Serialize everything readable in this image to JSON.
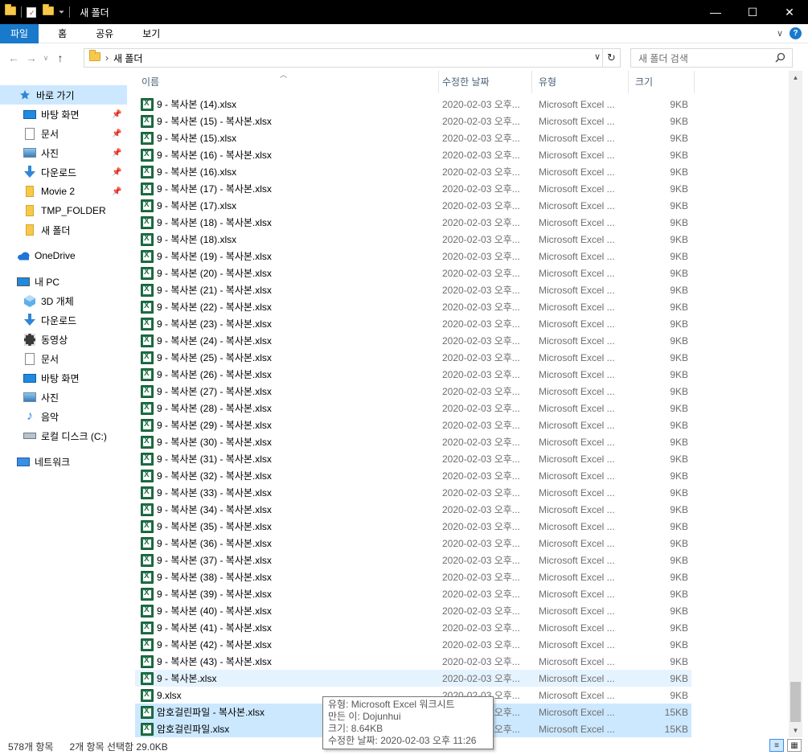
{
  "window": {
    "title": "새 폴더",
    "minimize": "—",
    "maximize": "☐",
    "close": "✕"
  },
  "ribbon": {
    "tabs": [
      "파일",
      "홈",
      "공유",
      "보기"
    ],
    "expand": "∨",
    "help": "?"
  },
  "address": {
    "back": "←",
    "forward": "→",
    "recent": "∨",
    "up": "↑",
    "separator": "›",
    "path": "새 폴더",
    "dropdown": "∨",
    "refresh": "↻"
  },
  "search": {
    "placeholder": "새 폴더 검색"
  },
  "nav": {
    "quick_access": "바로 가기",
    "items": [
      {
        "label": "바탕 화면",
        "icon": "desktop-icon",
        "pinned": true
      },
      {
        "label": "문서",
        "icon": "document-icon",
        "pinned": true
      },
      {
        "label": "사진",
        "icon": "pictures-icon",
        "pinned": true
      },
      {
        "label": "다운로드",
        "icon": "download-icon",
        "pinned": true
      },
      {
        "label": "Movie 2",
        "icon": "folder-icon",
        "pinned": true
      },
      {
        "label": "TMP_FOLDER",
        "icon": "folder-icon",
        "pinned": false
      },
      {
        "label": "새 폴더",
        "icon": "folder-icon",
        "pinned": false
      }
    ],
    "onedrive": "OneDrive",
    "thispc": "내 PC",
    "pc_items": [
      {
        "label": "3D 개체",
        "icon": "3d-objects-icon"
      },
      {
        "label": "다운로드",
        "icon": "download-icon"
      },
      {
        "label": "동영상",
        "icon": "video-icon"
      },
      {
        "label": "문서",
        "icon": "document-icon"
      },
      {
        "label": "바탕 화면",
        "icon": "desktop-icon"
      },
      {
        "label": "사진",
        "icon": "pictures-icon"
      },
      {
        "label": "음악",
        "icon": "music-icon"
      },
      {
        "label": "로컬 디스크 (C:)",
        "icon": "drive-icon"
      }
    ],
    "network": "네트워크"
  },
  "columns": {
    "name": "이름",
    "date": "수정한 날짜",
    "type": "유형",
    "size": "크기"
  },
  "files": [
    {
      "name": "9 - 복사본 (14).xlsx",
      "date": "2020-02-03 오후...",
      "type": "Microsoft Excel ...",
      "size": "9KB",
      "state": ""
    },
    {
      "name": "9 - 복사본 (15) - 복사본.xlsx",
      "date": "2020-02-03 오후...",
      "type": "Microsoft Excel ...",
      "size": "9KB",
      "state": ""
    },
    {
      "name": "9 - 복사본 (15).xlsx",
      "date": "2020-02-03 오후...",
      "type": "Microsoft Excel ...",
      "size": "9KB",
      "state": ""
    },
    {
      "name": "9 - 복사본 (16) - 복사본.xlsx",
      "date": "2020-02-03 오후...",
      "type": "Microsoft Excel ...",
      "size": "9KB",
      "state": ""
    },
    {
      "name": "9 - 복사본 (16).xlsx",
      "date": "2020-02-03 오후...",
      "type": "Microsoft Excel ...",
      "size": "9KB",
      "state": ""
    },
    {
      "name": "9 - 복사본 (17) - 복사본.xlsx",
      "date": "2020-02-03 오후...",
      "type": "Microsoft Excel ...",
      "size": "9KB",
      "state": ""
    },
    {
      "name": "9 - 복사본 (17).xlsx",
      "date": "2020-02-03 오후...",
      "type": "Microsoft Excel ...",
      "size": "9KB",
      "state": ""
    },
    {
      "name": "9 - 복사본 (18) - 복사본.xlsx",
      "date": "2020-02-03 오후...",
      "type": "Microsoft Excel ...",
      "size": "9KB",
      "state": ""
    },
    {
      "name": "9 - 복사본 (18).xlsx",
      "date": "2020-02-03 오후...",
      "type": "Microsoft Excel ...",
      "size": "9KB",
      "state": ""
    },
    {
      "name": "9 - 복사본 (19) - 복사본.xlsx",
      "date": "2020-02-03 오후...",
      "type": "Microsoft Excel ...",
      "size": "9KB",
      "state": ""
    },
    {
      "name": "9 - 복사본 (20) - 복사본.xlsx",
      "date": "2020-02-03 오후...",
      "type": "Microsoft Excel ...",
      "size": "9KB",
      "state": ""
    },
    {
      "name": "9 - 복사본 (21) - 복사본.xlsx",
      "date": "2020-02-03 오후...",
      "type": "Microsoft Excel ...",
      "size": "9KB",
      "state": ""
    },
    {
      "name": "9 - 복사본 (22) - 복사본.xlsx",
      "date": "2020-02-03 오후...",
      "type": "Microsoft Excel ...",
      "size": "9KB",
      "state": ""
    },
    {
      "name": "9 - 복사본 (23) - 복사본.xlsx",
      "date": "2020-02-03 오후...",
      "type": "Microsoft Excel ...",
      "size": "9KB",
      "state": ""
    },
    {
      "name": "9 - 복사본 (24) - 복사본.xlsx",
      "date": "2020-02-03 오후...",
      "type": "Microsoft Excel ...",
      "size": "9KB",
      "state": ""
    },
    {
      "name": "9 - 복사본 (25) - 복사본.xlsx",
      "date": "2020-02-03 오후...",
      "type": "Microsoft Excel ...",
      "size": "9KB",
      "state": ""
    },
    {
      "name": "9 - 복사본 (26) - 복사본.xlsx",
      "date": "2020-02-03 오후...",
      "type": "Microsoft Excel ...",
      "size": "9KB",
      "state": ""
    },
    {
      "name": "9 - 복사본 (27) - 복사본.xlsx",
      "date": "2020-02-03 오후...",
      "type": "Microsoft Excel ...",
      "size": "9KB",
      "state": ""
    },
    {
      "name": "9 - 복사본 (28) - 복사본.xlsx",
      "date": "2020-02-03 오후...",
      "type": "Microsoft Excel ...",
      "size": "9KB",
      "state": ""
    },
    {
      "name": "9 - 복사본 (29) - 복사본.xlsx",
      "date": "2020-02-03 오후...",
      "type": "Microsoft Excel ...",
      "size": "9KB",
      "state": ""
    },
    {
      "name": "9 - 복사본 (30) - 복사본.xlsx",
      "date": "2020-02-03 오후...",
      "type": "Microsoft Excel ...",
      "size": "9KB",
      "state": ""
    },
    {
      "name": "9 - 복사본 (31) - 복사본.xlsx",
      "date": "2020-02-03 오후...",
      "type": "Microsoft Excel ...",
      "size": "9KB",
      "state": ""
    },
    {
      "name": "9 - 복사본 (32) - 복사본.xlsx",
      "date": "2020-02-03 오후...",
      "type": "Microsoft Excel ...",
      "size": "9KB",
      "state": ""
    },
    {
      "name": "9 - 복사본 (33) - 복사본.xlsx",
      "date": "2020-02-03 오후...",
      "type": "Microsoft Excel ...",
      "size": "9KB",
      "state": ""
    },
    {
      "name": "9 - 복사본 (34) - 복사본.xlsx",
      "date": "2020-02-03 오후...",
      "type": "Microsoft Excel ...",
      "size": "9KB",
      "state": ""
    },
    {
      "name": "9 - 복사본 (35) - 복사본.xlsx",
      "date": "2020-02-03 오후...",
      "type": "Microsoft Excel ...",
      "size": "9KB",
      "state": ""
    },
    {
      "name": "9 - 복사본 (36) - 복사본.xlsx",
      "date": "2020-02-03 오후...",
      "type": "Microsoft Excel ...",
      "size": "9KB",
      "state": ""
    },
    {
      "name": "9 - 복사본 (37) - 복사본.xlsx",
      "date": "2020-02-03 오후...",
      "type": "Microsoft Excel ...",
      "size": "9KB",
      "state": ""
    },
    {
      "name": "9 - 복사본 (38) - 복사본.xlsx",
      "date": "2020-02-03 오후...",
      "type": "Microsoft Excel ...",
      "size": "9KB",
      "state": ""
    },
    {
      "name": "9 - 복사본 (39) - 복사본.xlsx",
      "date": "2020-02-03 오후...",
      "type": "Microsoft Excel ...",
      "size": "9KB",
      "state": ""
    },
    {
      "name": "9 - 복사본 (40) - 복사본.xlsx",
      "date": "2020-02-03 오후...",
      "type": "Microsoft Excel ...",
      "size": "9KB",
      "state": ""
    },
    {
      "name": "9 - 복사본 (41) - 복사본.xlsx",
      "date": "2020-02-03 오후...",
      "type": "Microsoft Excel ...",
      "size": "9KB",
      "state": ""
    },
    {
      "name": "9 - 복사본 (42) - 복사본.xlsx",
      "date": "2020-02-03 오후...",
      "type": "Microsoft Excel ...",
      "size": "9KB",
      "state": ""
    },
    {
      "name": "9 - 복사본 (43) - 복사본.xlsx",
      "date": "2020-02-03 오후...",
      "type": "Microsoft Excel ...",
      "size": "9KB",
      "state": ""
    },
    {
      "name": "9 - 복사본.xlsx",
      "date": "2020-02-03 오후...",
      "type": "Microsoft Excel ...",
      "size": "9KB",
      "state": "hover"
    },
    {
      "name": "9.xlsx",
      "date": "2020-02-03 오후...",
      "type": "Microsoft Excel ...",
      "size": "9KB",
      "state": ""
    },
    {
      "name": "암호걸린파일 - 복사본.xlsx",
      "date": "2020-02-03 오후...",
      "type": "Microsoft Excel ...",
      "size": "15KB",
      "state": "sel"
    },
    {
      "name": "암호걸린파일.xlsx",
      "date": "2020-02-03 오후...",
      "type": "Microsoft Excel ...",
      "size": "15KB",
      "state": "sel"
    }
  ],
  "tooltip": {
    "line1": "유형: Microsoft Excel 워크시트",
    "line2": "만든 이: Dojunhui",
    "line3": "크기: 8.64KB",
    "line4": "수정한 날짜: 2020-02-03 오후 11:26"
  },
  "status": {
    "count": "578개 항목",
    "selection": "2개 항목 선택함 29.0KB"
  },
  "colors": {
    "accent": "#1979ca",
    "selected": "#cce8ff",
    "hover": "#e5f3ff"
  }
}
